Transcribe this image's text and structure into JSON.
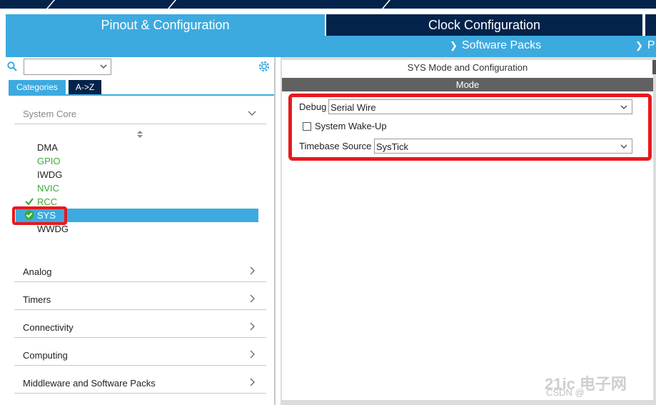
{
  "header": {
    "tab_pinout": "Pinout & Configuration",
    "tab_clock": "Clock Configuration",
    "software_packs": "Software Packs",
    "right_cutoff": "P"
  },
  "sidebar": {
    "search_value": "",
    "tabs": {
      "categories": "Categories",
      "az": "A->Z"
    },
    "system_core": {
      "label": "System Core",
      "items": [
        {
          "label": "DMA",
          "status": "none"
        },
        {
          "label": "GPIO",
          "status": "configured"
        },
        {
          "label": "IWDG",
          "status": "none"
        },
        {
          "label": "NVIC",
          "status": "configured"
        },
        {
          "label": "RCC",
          "status": "check"
        },
        {
          "label": "SYS",
          "status": "selected-check"
        },
        {
          "label": "WWDG",
          "status": "none"
        }
      ]
    },
    "categories": [
      {
        "label": "Analog"
      },
      {
        "label": "Timers"
      },
      {
        "label": "Connectivity"
      },
      {
        "label": "Computing"
      },
      {
        "label": "Middleware and Software Packs"
      }
    ]
  },
  "main": {
    "title": "SYS Mode and Configuration",
    "mode_header": "Mode",
    "debug": {
      "label": "Debug",
      "value": "Serial Wire"
    },
    "wakeup": {
      "label": "System Wake-Up",
      "checked": false
    },
    "timebase": {
      "label": "Timebase Source",
      "value": "SysTick"
    }
  },
  "watermark": {
    "main": "21ic 电子网",
    "sub": "CSDN @"
  },
  "colors": {
    "accent_blue": "#3caadf",
    "navy": "#03234b",
    "mode_bar": "#616161",
    "highlight_red": "#e8191d",
    "configured_green": "#3aaa35"
  },
  "icons": [
    "search-icon",
    "chevron-down-icon",
    "gear-icon",
    "sort-icon",
    "check-icon",
    "chevron-right-icon"
  ]
}
